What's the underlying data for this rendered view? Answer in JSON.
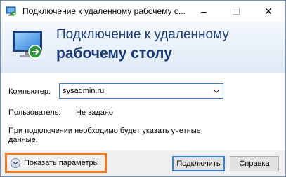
{
  "window": {
    "title": "Подключение к удаленному рабочему с...",
    "minimize_label": "–",
    "close_label": "✕"
  },
  "banner": {
    "line1": "Подключение к удаленному",
    "line2": "рабочему столу"
  },
  "form": {
    "computer_label": "Компьютер:",
    "computer_value": "sysadmin.ru",
    "user_label": "Пользователь:",
    "user_value": "Не задано",
    "info_line1": "При подключении необходимо будет указать учетные",
    "info_line2": "данные."
  },
  "footer": {
    "show_options_label": "Показать параметры",
    "connect_label": "Подключить",
    "help_label": "Справка"
  },
  "icons": {
    "app": "remote-desktop-icon",
    "combo_arrow": "chevron-down-icon",
    "options": "expand-options-icon"
  },
  "colors": {
    "heading": "#1a3b73",
    "highlight": "#f37a1f",
    "focus": "#3c7fd2"
  }
}
